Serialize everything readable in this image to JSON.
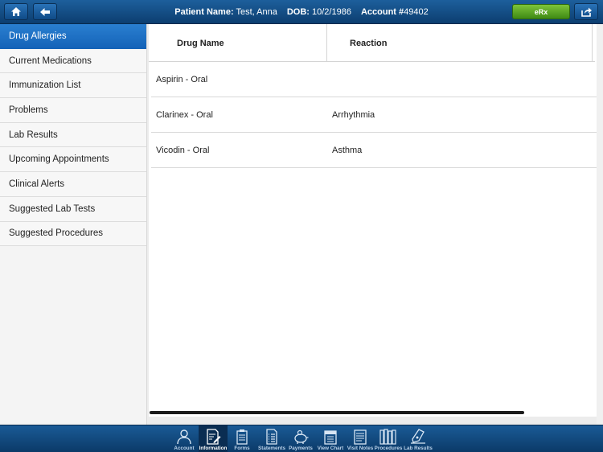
{
  "header": {
    "patient_label": "Patient Name:",
    "patient_value": "Test, Anna",
    "dob_label": "DOB:",
    "dob_value": "10/2/1986",
    "account_label": "Account #",
    "account_value": "49402",
    "erx_label": "eRx"
  },
  "sidebar": {
    "items": [
      {
        "label": "Drug Allergies"
      },
      {
        "label": "Current Medications"
      },
      {
        "label": "Immunization List"
      },
      {
        "label": "Problems"
      },
      {
        "label": "Lab Results"
      },
      {
        "label": "Upcoming Appointments"
      },
      {
        "label": "Clinical Alerts"
      },
      {
        "label": "Suggested Lab Tests"
      },
      {
        "label": "Suggested Procedures"
      }
    ]
  },
  "table": {
    "columns": [
      "Drug Name",
      "Reaction"
    ],
    "rows": [
      [
        "Aspirin - Oral",
        ""
      ],
      [
        "Clarinex - Oral",
        "Arrhythmia"
      ],
      [
        "Vicodin - Oral",
        "Asthma"
      ]
    ]
  },
  "tabbar": {
    "tabs": [
      {
        "label": "Account",
        "icon": "person-icon"
      },
      {
        "label": "Information",
        "icon": "document-edit-icon"
      },
      {
        "label": "Forms",
        "icon": "clipboard-icon"
      },
      {
        "label": "Statements",
        "icon": "list-document-icon"
      },
      {
        "label": "Payments",
        "icon": "piggy-bank-icon"
      },
      {
        "label": "View Chart",
        "icon": "chart-binder-icon"
      },
      {
        "label": "Visit Notes",
        "icon": "notes-icon"
      },
      {
        "label": "Procedures",
        "icon": "books-icon"
      },
      {
        "label": "Lab Results",
        "icon": "flask-icon"
      }
    ]
  }
}
